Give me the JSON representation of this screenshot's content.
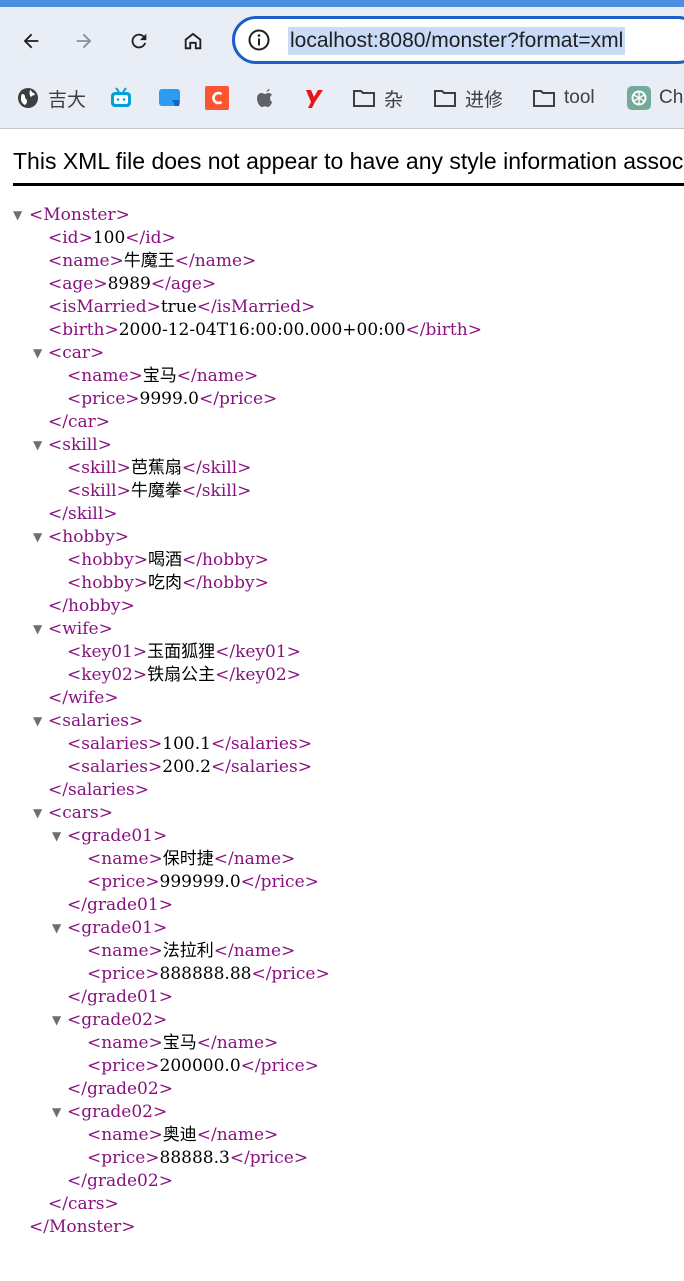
{
  "browser": {
    "url": "localhost:8080/monster?format=xml",
    "bookmarks": [
      {
        "label": "吉大",
        "icon": "globe-icon"
      },
      {
        "label": "",
        "icon": "bilibili-icon"
      },
      {
        "label": "",
        "icon": "chat-bubble-icon"
      },
      {
        "label": "",
        "icon": "csdn-icon"
      },
      {
        "label": "",
        "icon": "apple-icon"
      },
      {
        "label": "",
        "icon": "y-logo-icon"
      },
      {
        "label": "杂",
        "icon": "folder-icon"
      },
      {
        "label": "进修",
        "icon": "folder-icon"
      },
      {
        "label": "tool",
        "icon": "folder-icon"
      },
      {
        "label": "Cha",
        "icon": "chatgpt-icon"
      }
    ],
    "accent": "#1a5fc8"
  },
  "viewer": {
    "notice": "This XML file does not appear to have any style information associated with it."
  },
  "xml": {
    "root_open": "<Monster>",
    "root_close": "</Monster>",
    "fields": [
      {
        "open": "<id>",
        "value": "100",
        "close": "</id>"
      },
      {
        "open": "<name>",
        "value": "牛魔王",
        "close": "</name>"
      },
      {
        "open": "<age>",
        "value": "8989",
        "close": "</age>"
      },
      {
        "open": "<isMarried>",
        "value": "true",
        "close": "</isMarried>"
      },
      {
        "open": "<birth>",
        "value": "2000-12-04T16:00:00.000+00:00",
        "close": "</birth>"
      }
    ],
    "car": {
      "open": "<car>",
      "close": "</car>",
      "children": [
        {
          "open": "<name>",
          "value": "宝马",
          "close": "</name>"
        },
        {
          "open": "<price>",
          "value": "9999.0",
          "close": "</price>"
        }
      ]
    },
    "skill": {
      "open": "<skill>",
      "close": "</skill>",
      "children": [
        {
          "open": "<skill>",
          "value": "芭蕉扇",
          "close": "</skill>"
        },
        {
          "open": "<skill>",
          "value": "牛魔拳",
          "close": "</skill>"
        }
      ]
    },
    "hobby": {
      "open": "<hobby>",
      "close": "</hobby>",
      "children": [
        {
          "open": "<hobby>",
          "value": "喝酒",
          "close": "</hobby>"
        },
        {
          "open": "<hobby>",
          "value": "吃肉",
          "close": "</hobby>"
        }
      ]
    },
    "wife": {
      "open": "<wife>",
      "close": "</wife>",
      "children": [
        {
          "open": "<key01>",
          "value": "玉面狐狸",
          "close": "</key01>"
        },
        {
          "open": "<key02>",
          "value": "铁扇公主",
          "close": "</key02>"
        }
      ]
    },
    "salaries": {
      "open": "<salaries>",
      "close": "</salaries>",
      "children": [
        {
          "open": "<salaries>",
          "value": "100.1",
          "close": "</salaries>"
        },
        {
          "open": "<salaries>",
          "value": "200.2",
          "close": "</salaries>"
        }
      ]
    },
    "cars": {
      "open": "<cars>",
      "close": "</cars>",
      "groups": [
        {
          "open": "<grade01>",
          "close": "</grade01>",
          "children": [
            {
              "open": "<name>",
              "value": "保时捷",
              "close": "</name>"
            },
            {
              "open": "<price>",
              "value": "999999.0",
              "close": "</price>"
            }
          ]
        },
        {
          "open": "<grade01>",
          "close": "</grade01>",
          "children": [
            {
              "open": "<name>",
              "value": "法拉利",
              "close": "</name>"
            },
            {
              "open": "<price>",
              "value": "888888.88",
              "close": "</price>"
            }
          ]
        },
        {
          "open": "<grade02>",
          "close": "</grade02>",
          "children": [
            {
              "open": "<name>",
              "value": "宝马",
              "close": "</name>"
            },
            {
              "open": "<price>",
              "value": "200000.0",
              "close": "</price>"
            }
          ]
        },
        {
          "open": "<grade02>",
          "close": "</grade02>",
          "children": [
            {
              "open": "<name>",
              "value": "奥迪",
              "close": "</name>"
            },
            {
              "open": "<price>",
              "value": "88888.3",
              "close": "</price>"
            }
          ]
        }
      ]
    }
  }
}
